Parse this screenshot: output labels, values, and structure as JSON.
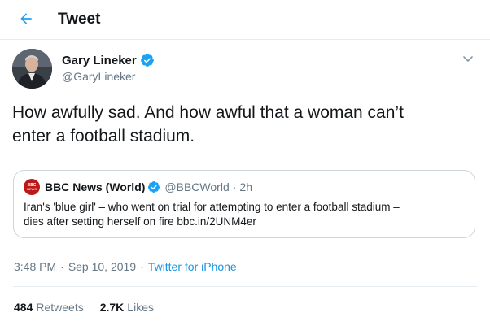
{
  "header": {
    "title": "Tweet"
  },
  "author": {
    "name": "Gary Lineker",
    "handle": "@GaryLineker",
    "avatar_icon": "user-avatar",
    "verified_icon": "verified-badge-icon"
  },
  "tweet": {
    "line1": "How awfully sad. And how awful that a woman can’t",
    "line2": "enter a football stadium."
  },
  "quote": {
    "logo_top": "BBC",
    "logo_bottom": "NEWS",
    "name": "BBC News (World)",
    "handle": "@BBCWorld",
    "dot": "·",
    "time": "2h",
    "line1": "Iran's 'blue girl' – who went on trial for attempting to enter a football stadium –",
    "line2": "dies after setting herself on fire bbc.in/2UNM4er"
  },
  "meta": {
    "time": "3:48 PM",
    "dot1": "·",
    "date": "Sep 10, 2019",
    "dot2": "·",
    "source": "Twitter for iPhone"
  },
  "stats": {
    "retweets_count": "484",
    "retweets_label": "Retweets",
    "likes_count": "2.7K",
    "likes_label": "Likes"
  },
  "colors": {
    "accent": "#1da1f2",
    "link": "#1b95e0",
    "secondary_text": "#657786",
    "border": "#e6ecf0",
    "bbc_red": "#bb1919"
  }
}
